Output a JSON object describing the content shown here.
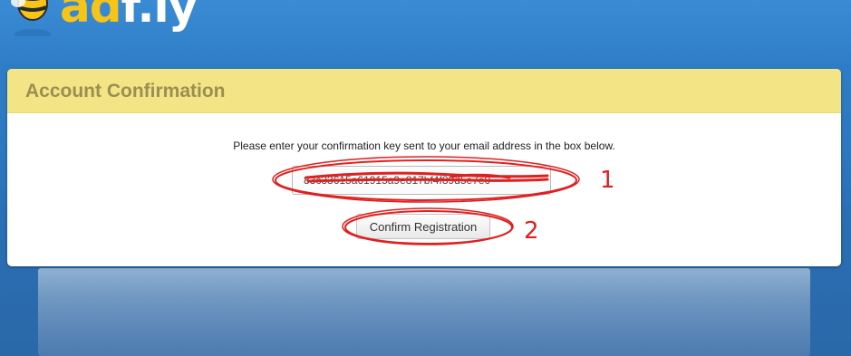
{
  "header": {
    "logo": {
      "text_ad": "ad",
      "text_fly": "f.ly",
      "icon": "bee-icon"
    }
  },
  "panel": {
    "title": "Account Confirmation",
    "instructions": "Please enter your confirmation key sent to your email address in the box below.",
    "key_input": {
      "value": "83c33615a61915a9e817bf4f89d5e7e0"
    },
    "confirm_button_label": "Confirm Registration"
  },
  "annotations": {
    "marker_1": "1",
    "marker_2": "2",
    "color": "#e02020"
  },
  "colors": {
    "background_blue": "#2f7fc9",
    "panel_header_yellow": "#f3e485",
    "panel_title": "#9a8f52",
    "logo_yellow": "#f7c418"
  }
}
